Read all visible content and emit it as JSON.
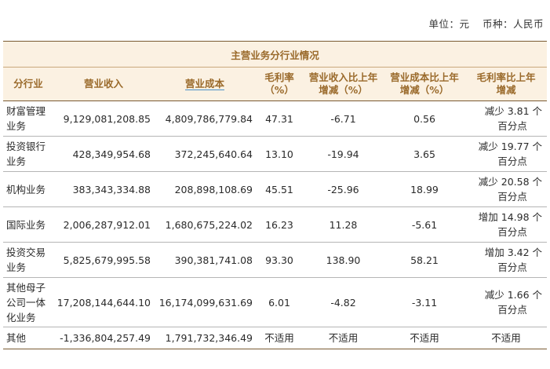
{
  "unit": {
    "unit_label": "单位：元",
    "currency_label": "币种：人民币"
  },
  "table": {
    "caption": "主营业务分行业情况",
    "headers": [
      "分行业",
      "营业收入",
      "营业成本",
      "毛利率\n（%）",
      "营业收入比上年\n增减（%）",
      "营业成本比上年\n增减（%）",
      "毛利率比上年\n增减"
    ],
    "rows": [
      {
        "segment": "财富管理\n业务",
        "revenue": "9,129,081,208.85",
        "cost": "4,809,786,779.84",
        "margin": "47.31",
        "rev_change": "-6.71",
        "cost_change": "0.56",
        "margin_change_1": "减少 3.81 个",
        "margin_change_2": "百分点"
      },
      {
        "segment": "投资银行\n业务",
        "revenue": "428,349,954.68",
        "cost": "372,245,640.64",
        "margin": "13.10",
        "rev_change": "-19.94",
        "cost_change": "3.65",
        "margin_change_1": "减少 19.77 个",
        "margin_change_2": "百分点"
      },
      {
        "segment": "机构业务",
        "revenue": "383,343,334.88",
        "cost": "208,898,108.69",
        "margin": "45.51",
        "rev_change": "-25.96",
        "cost_change": "18.99",
        "margin_change_1": "减少 20.58 个",
        "margin_change_2": "百分点"
      },
      {
        "segment": "国际业务",
        "revenue": "2,006,287,912.01",
        "cost": "1,680,675,224.02",
        "margin": "16.23",
        "rev_change": "11.28",
        "cost_change": "-5.61",
        "margin_change_1": "增加 14.98 个",
        "margin_change_2": "百分点"
      },
      {
        "segment": "投资交易\n业务",
        "revenue": "5,825,679,995.58",
        "cost": "390,381,741.08",
        "margin": "93.30",
        "rev_change": "138.90",
        "cost_change": "58.21",
        "margin_change_1": "增加 3.42 个",
        "margin_change_2": "百分点"
      },
      {
        "segment": "其他母子\n公司一体\n化业务",
        "revenue": "17,208,144,644.10",
        "cost": "16,174,099,631.69",
        "margin": "6.01",
        "rev_change": "-4.82",
        "cost_change": "-3.11",
        "margin_change_1": "减少 1.66 个",
        "margin_change_2": "百分点"
      },
      {
        "segment": "其他",
        "revenue": "-1,336,804,257.49",
        "cost": "1,791,732,346.49",
        "margin": "不适用",
        "rev_change": "不适用",
        "cost_change": "不适用",
        "margin_change_1": "不适用",
        "margin_change_2": ""
      }
    ]
  }
}
